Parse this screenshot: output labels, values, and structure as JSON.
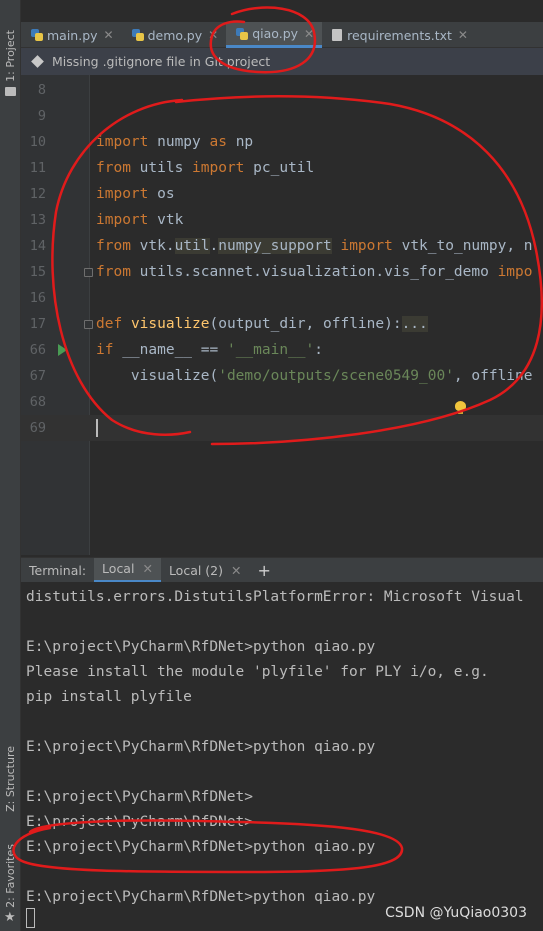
{
  "tool_windows": {
    "project_label": "1: Project",
    "structure_label": "Z: Structure",
    "favorites_label": "2: Favorites"
  },
  "tabs": [
    {
      "label": "main.py",
      "icon": "python-file-icon",
      "active": false
    },
    {
      "label": "demo.py",
      "icon": "python-file-icon",
      "active": false
    },
    {
      "label": "qiao.py",
      "icon": "python-file-icon",
      "active": true
    },
    {
      "label": "requirements.txt",
      "icon": "text-file-icon",
      "active": false
    }
  ],
  "banner": {
    "text": "Missing .gitignore file in Git project"
  },
  "editor": {
    "lines": [
      {
        "num": "8"
      },
      {
        "num": "9"
      },
      {
        "num": "10"
      },
      {
        "num": "11"
      },
      {
        "num": "12"
      },
      {
        "num": "13"
      },
      {
        "num": "14"
      },
      {
        "num": "15"
      },
      {
        "num": "16"
      },
      {
        "num": "17"
      },
      {
        "num": "66"
      },
      {
        "num": "67"
      },
      {
        "num": "68"
      },
      {
        "num": "69"
      }
    ],
    "tokens": {
      "l10_a": "import",
      "l10_b": " numpy ",
      "l10_c": "as",
      "l10_d": " np",
      "l11_a": "from",
      "l11_b": " utils ",
      "l11_c": "import",
      "l11_d": " pc_util",
      "l12_a": "import",
      "l12_b": " os",
      "l13_a": "import",
      "l13_b": " vtk",
      "l14_a": "from",
      "l14_b": " vtk.",
      "l14_c": "util",
      "l14_d": ".",
      "l14_e": "numpy_support",
      "l14_f": " ",
      "l14_g": "import",
      "l14_h": " vtk_to_numpy, n",
      "l15_a": "from",
      "l15_b": " utils.scannet.visualization.vis_for_demo ",
      "l15_c": "impo",
      "l17_a": "def",
      "l17_b": " ",
      "l17_c": "visualize",
      "l17_d": "(output_dir, offline):",
      "l17_e": "...",
      "l66_a": "if",
      "l66_b": " __name__ == ",
      "l66_c": "'__main__'",
      "l66_d": ":",
      "l67_a": "    visualize(",
      "l67_b": "'demo/outputs/scene0549_00'",
      "l67_c": ", offline"
    }
  },
  "terminal": {
    "title": "Terminal:",
    "tabs": [
      {
        "label": "Local",
        "active": true
      },
      {
        "label": "Local (2)",
        "active": false
      }
    ],
    "add_label": "+",
    "lines": [
      "distutils.errors.DistutilsPlatformError: Microsoft Visual",
      "",
      "E:\\project\\PyCharm\\RfDNet>python qiao.py",
      "Please install the module 'plyfile' for PLY i/o, e.g.",
      "pip install plyfile",
      "",
      "E:\\project\\PyCharm\\RfDNet>python qiao.py",
      "",
      "E:\\project\\PyCharm\\RfDNet>",
      "E:\\project\\PyCharm\\RfDNet>",
      "E:\\project\\PyCharm\\RfDNet>python qiao.py",
      "",
      "E:\\project\\PyCharm\\RfDNet>python qiao.py"
    ]
  },
  "watermark": "CSDN @YuQiao0303",
  "colors": {
    "keyword": "#cc7832",
    "function": "#ffc66d",
    "string": "#6a8759",
    "annotation": "#e01b1b",
    "active_tab_underline": "#4a88c7"
  }
}
